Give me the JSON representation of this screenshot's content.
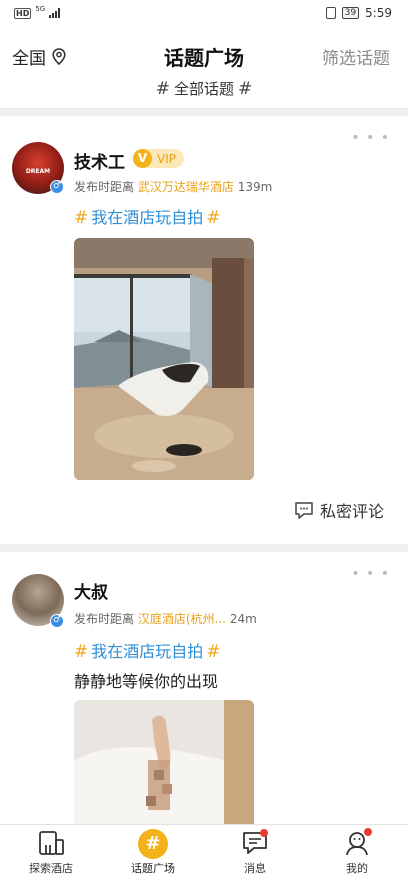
{
  "status_bar": {
    "hd": "HD",
    "network": "5G",
    "battery": "39",
    "time": "5:59"
  },
  "header": {
    "region": "全国",
    "title": "话题广场",
    "filter_label": "筛选话题",
    "all_topics": "全部话题"
  },
  "posts": [
    {
      "username": "技术工",
      "badge": "VIP",
      "meta_prefix": "发布时距离",
      "hotel": "武汉万达瑞华酒店",
      "distance": "139m",
      "topic": "我在酒店玩自拍",
      "action": "私密评论"
    },
    {
      "username": "大叔",
      "meta_prefix": "发布时距离",
      "hotel": "汉庭酒店(杭州...",
      "distance": "24m",
      "topic": "我在酒店玩自拍",
      "text": "静静地等候你的出现"
    }
  ],
  "tabs": [
    {
      "label": "探索酒店",
      "icon": "building-icon"
    },
    {
      "label": "话题广场",
      "icon": "hashtag-icon",
      "active": true
    },
    {
      "label": "消息",
      "icon": "message-icon",
      "badge_dot": true
    },
    {
      "label": "我的",
      "icon": "profile-icon",
      "badge_dot": true
    }
  ],
  "colors": {
    "accent": "#f3b21a",
    "hotel_link": "#e6a11a",
    "topic_link": "#2f8fd6",
    "gender_male": "#3a8ee6",
    "badge_dot": "#e83a2f"
  }
}
